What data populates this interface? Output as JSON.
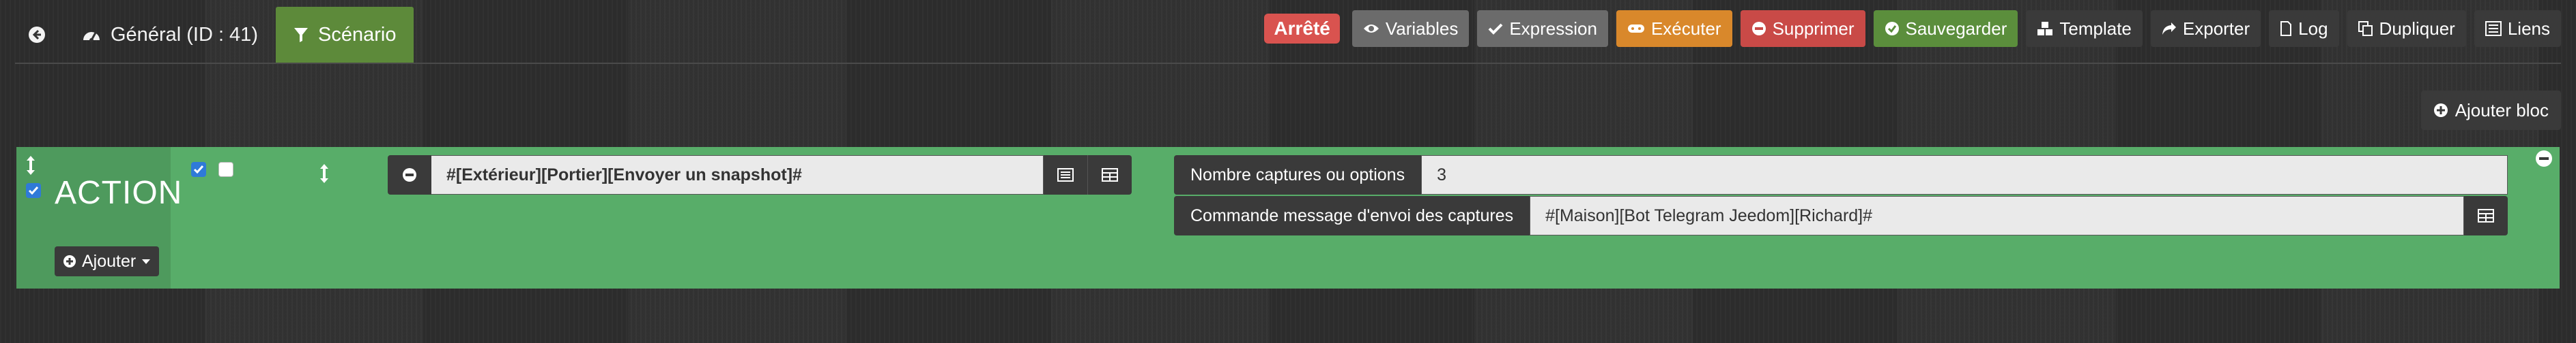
{
  "header": {
    "back_icon": "circle-arrow-left-icon",
    "tabs": [
      {
        "label": "Général (ID : 41)",
        "icon": "dashboard-icon"
      },
      {
        "label": "Scénario",
        "icon": "filter-icon"
      }
    ],
    "status": {
      "label": "Arrêté",
      "color": "#d9534f"
    },
    "buttons": {
      "variables": "Variables",
      "expression": "Expression",
      "executer": "Exécuter",
      "supprimer": "Supprimer",
      "sauvegarder": "Sauvegarder",
      "template": "Template",
      "exporter": "Exporter",
      "log": "Log",
      "dupliquer": "Dupliquer",
      "liens": "Liens"
    }
  },
  "add_block": {
    "label": "Ajouter bloc"
  },
  "action_block": {
    "title": "ACTION",
    "add_label": "Ajouter",
    "block_color": "#58ad69",
    "command": {
      "value": "#[Extérieur][Portier][Envoyer un snapshot]#"
    },
    "options": [
      {
        "label": "Nombre captures ou options",
        "value": "3"
      },
      {
        "label": "Commande message d'envoi des captures",
        "value": "#[Maison][Bot Telegram Jeedom][Richard]#"
      }
    ]
  },
  "colors": {
    "active_tab": "#5d8a3a",
    "danger": "#c94a47",
    "warning": "#d9882b",
    "success": "#5b8e3c",
    "default": "#6b6b6b",
    "dark": "#3a3a3a"
  }
}
